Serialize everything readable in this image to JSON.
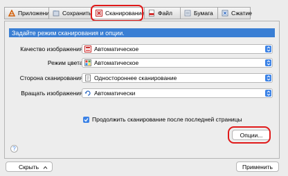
{
  "tabs": [
    {
      "label": "Приложение",
      "icon": "application-icon"
    },
    {
      "label": "Сохранить",
      "icon": "save-icon"
    },
    {
      "label": "Сканирование",
      "icon": "scan-icon",
      "active": true
    },
    {
      "label": "Файл",
      "icon": "pdf-file-icon"
    },
    {
      "label": "Бумага",
      "icon": "paper-icon"
    },
    {
      "label": "Сжатие",
      "icon": "compression-icon"
    }
  ],
  "section_header": "Задайте режим сканирования и опции.",
  "settings": [
    {
      "label": "Качество изображения:",
      "value": "Автоматическое",
      "icon": "image-quality-icon"
    },
    {
      "label": "Режим цвета:",
      "value": "Автоматическое",
      "icon": "color-mode-icon"
    },
    {
      "label": "Сторона сканирования:",
      "value": "Одностороннее сканирование",
      "icon": "single-sided-icon"
    },
    {
      "label": "Вращать изображения:",
      "value": "Автоматически",
      "icon": "rotate-icon"
    }
  ],
  "continue_checkbox": {
    "label": "Продолжить сканирование после последней страницы",
    "checked": true
  },
  "options_button": "Опции...",
  "help_label": "?",
  "hide_button": "Скрыть",
  "apply_button": "Применить",
  "colors": {
    "accent": "#3b82e6",
    "header": "#3a7fd4",
    "highlight": "#e01919"
  }
}
